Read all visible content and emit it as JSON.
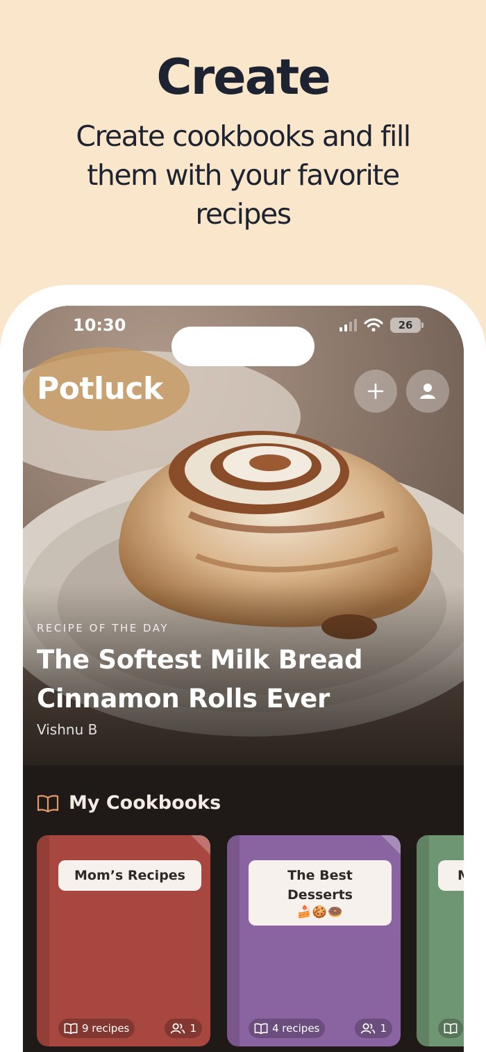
{
  "promo": {
    "title": "Create",
    "subtitle": "Create cookbooks and fill them with your favorite recipes"
  },
  "status_bar": {
    "time": "10:30",
    "battery": "26"
  },
  "header": {
    "app_title": "Potluck",
    "add_icon": "plus-icon",
    "profile_icon": "person-icon"
  },
  "recipe_of_the_day": {
    "label": "RECIPE OF THE DAY",
    "title": "The Softest Milk Bread Cinnamon Rolls Ever",
    "author": "Vishnu B"
  },
  "cookbooks_section": {
    "icon": "book-icon",
    "title": "My Cookbooks",
    "items": [
      {
        "name": "Mom’s Recipes",
        "emoji": "",
        "recipes": "9 recipes",
        "members": "1",
        "color": "#a8473f"
      },
      {
        "name": "The Best Desserts",
        "emoji": "🍰🍪🍩",
        "recipes": "4 recipes",
        "members": "1",
        "color": "#8a64a0"
      },
      {
        "name": "M",
        "emoji": "",
        "recipes": "",
        "members": "",
        "color": "#6f9672"
      }
    ]
  },
  "colors": {
    "background": "#fae7cb",
    "heading_text": "#1d2330",
    "screen_dark": "#1f1a17",
    "accent_orange": "#e39a6a"
  }
}
